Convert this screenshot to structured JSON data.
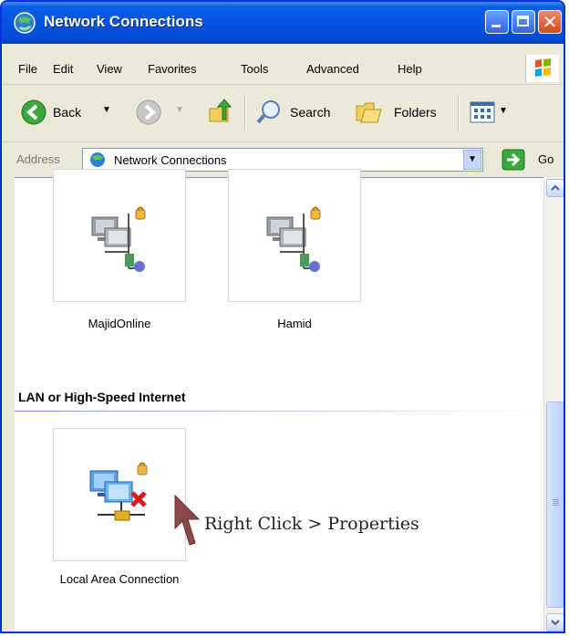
{
  "window": {
    "title": "Network Connections"
  },
  "menu": [
    "File",
    "Edit",
    "View",
    "Favorites",
    "Tools",
    "Advanced",
    "Help"
  ],
  "toolbar": {
    "back_label": "Back",
    "search_label": "Search",
    "folders_label": "Folders"
  },
  "address": {
    "label": "Address",
    "value": "Network Connections",
    "go_label": "Go"
  },
  "connections": [
    {
      "name": "MajidOnline",
      "icon": "dialup-connection-icon"
    },
    {
      "name": "Hamid",
      "icon": "dialup-connection-icon"
    }
  ],
  "lan_group": {
    "header": "LAN or High-Speed Internet",
    "items": [
      {
        "name": "Local Area Connection",
        "icon": "lan-connection-disabled-icon"
      }
    ]
  },
  "annotation": "Right Click > Properties",
  "colors": {
    "titlebar": "#0553e2",
    "chrome": "#ece9d8",
    "close": "#d24a1f",
    "annotation_arrow": "#8b4a4a"
  }
}
